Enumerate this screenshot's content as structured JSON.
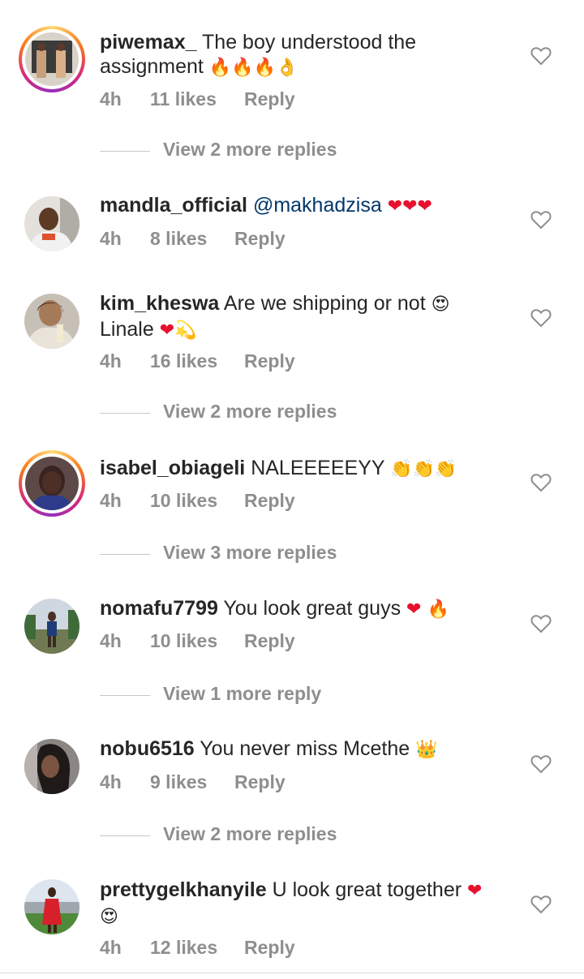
{
  "comments": [
    {
      "username": "piwemax_",
      "text_line1": "The boy understood the",
      "text_line2": "assignment",
      "emoji_line2": "🔥🔥🔥👌",
      "time": "4h",
      "likes": "11 likes",
      "reply": "Reply",
      "view_replies": "View 2 more replies"
    },
    {
      "username": "mandla_official",
      "mention": "@makhadzisa",
      "emoji": "❤❤❤",
      "time": "4h",
      "likes": "8 likes",
      "reply": "Reply"
    },
    {
      "username": "kim_kheswa",
      "text_line1": "Are we shipping or not",
      "emoji_line1": "😍",
      "text_line2": "Linale",
      "emoji_line2": "❤💫",
      "time": "4h",
      "likes": "16 likes",
      "reply": "Reply",
      "view_replies": "View 2 more replies"
    },
    {
      "username": "isabel_obiageli",
      "text_line1": "NALEEEEEYY",
      "emoji_line1": "👏👏👏",
      "time": "4h",
      "likes": "10 likes",
      "reply": "Reply",
      "view_replies": "View 3 more replies"
    },
    {
      "username": "nomafu7799",
      "text_line1": "You look great guys",
      "emoji_line1": "❤ 🔥",
      "time": "4h",
      "likes": "10 likes",
      "reply": "Reply",
      "view_replies": "View 1 more reply"
    },
    {
      "username": "nobu6516",
      "text_line1": "You never miss Mcethe",
      "emoji_line1": "👑",
      "time": "4h",
      "likes": "9 likes",
      "reply": "Reply",
      "view_replies": "View 2 more replies"
    },
    {
      "username": "prettygelkhanyile",
      "text_line1": "U look great together",
      "emoji_line1": "❤",
      "emoji_line2": "😍",
      "time": "4h",
      "likes": "12 likes",
      "reply": "Reply"
    }
  ],
  "icons": {
    "like": "heart-outline-icon"
  },
  "colors": {
    "heart_red": "#e8112d",
    "muted": "#8e8e8e",
    "mention": "#00376b"
  }
}
